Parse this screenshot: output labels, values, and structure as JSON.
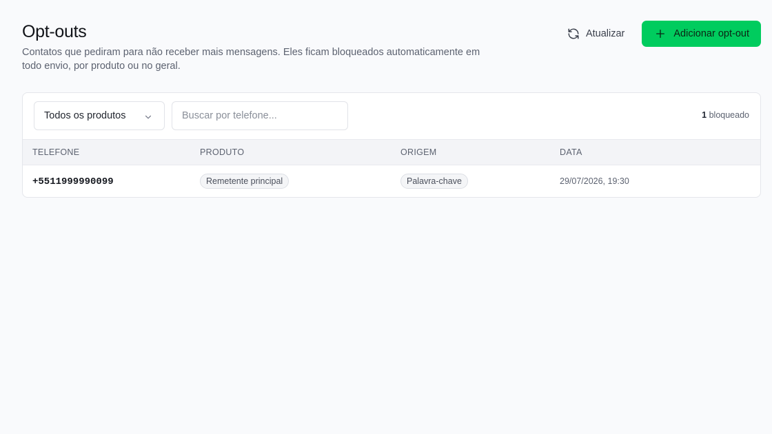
{
  "header": {
    "title": "Opt-outs",
    "description": "Contatos que pediram para não receber mais mensagens. Eles ficam bloqueados automaticamente em todo envio, por produto ou no geral."
  },
  "actions": {
    "refresh_label": "Atualizar",
    "refresh_icon": "refresh-icon",
    "add_label": "Adicionar opt-out",
    "add_icon": "plus-icon"
  },
  "filters": {
    "product_select": "Todos os produtos",
    "search_placeholder": "Buscar por telefone...",
    "count_number": "1",
    "count_label": "bloqueado"
  },
  "table": {
    "columns": [
      "TELEFONE",
      "PRODUTO",
      "ORIGEM",
      "DATA"
    ],
    "rows": [
      {
        "phone": "+5511999990099",
        "product": "Remetente principal",
        "origin": "Palavra-chave",
        "date": "29/07/2026, 19:30"
      }
    ]
  },
  "colors": {
    "accent": "#00cc5e",
    "background": "#f9fafc"
  }
}
